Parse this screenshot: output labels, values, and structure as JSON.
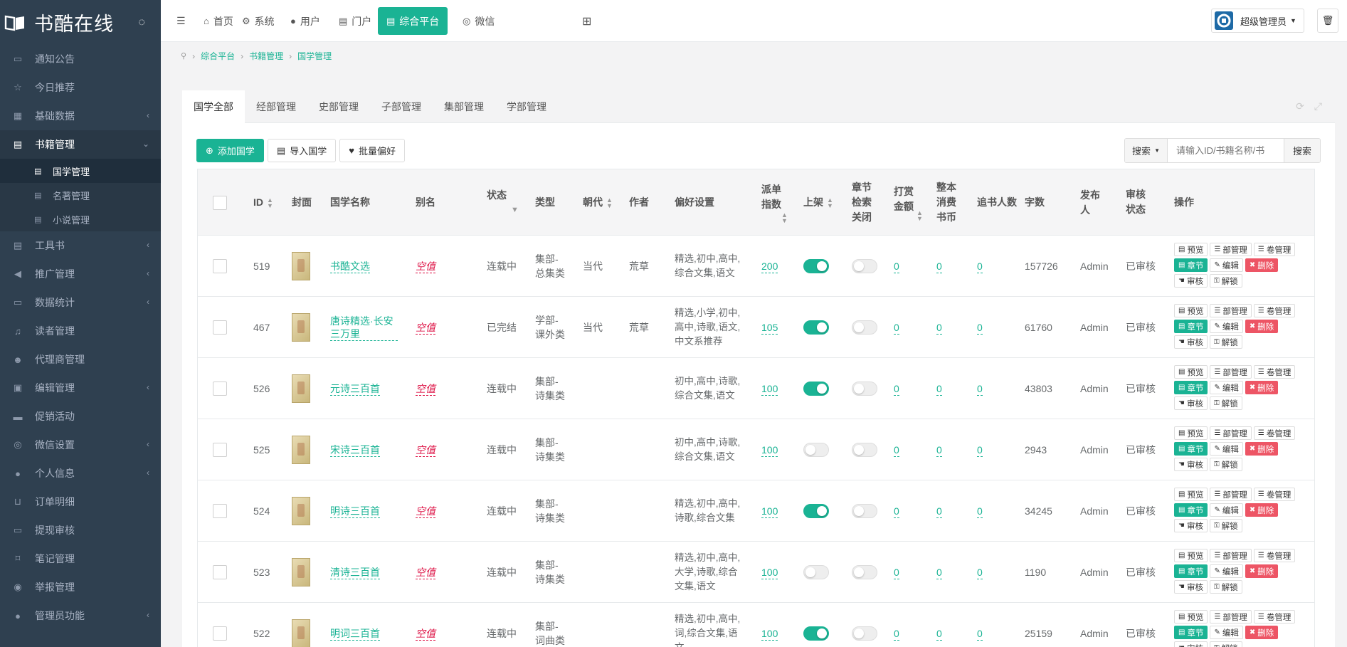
{
  "app": {
    "title": "书酷在线"
  },
  "sidebar": {
    "items": [
      {
        "label": "通知公告",
        "icon": "folder-icon",
        "arrow": false
      },
      {
        "label": "今日推荐",
        "icon": "star-icon",
        "arrow": false
      },
      {
        "label": "基础数据",
        "icon": "cubes-icon",
        "arrow": true
      },
      {
        "label": "书籍管理",
        "icon": "book-icon",
        "arrow": true,
        "active": true
      },
      {
        "label": "工具书",
        "icon": "book-icon",
        "arrow": true
      },
      {
        "label": "推广管理",
        "icon": "bullhorn-icon",
        "arrow": true
      },
      {
        "label": "数据统计",
        "icon": "folder-icon",
        "arrow": true
      },
      {
        "label": "读者管理",
        "icon": "headphones-icon",
        "arrow": false
      },
      {
        "label": "代理商管理",
        "icon": "users-icon",
        "arrow": false
      },
      {
        "label": "编辑管理",
        "icon": "user-card-icon",
        "arrow": true
      },
      {
        "label": "促销活动",
        "icon": "laptop-icon",
        "arrow": false
      },
      {
        "label": "微信设置",
        "icon": "wechat-icon",
        "arrow": true
      },
      {
        "label": "个人信息",
        "icon": "user-icon",
        "arrow": true
      },
      {
        "label": "订单明细",
        "icon": "cart-icon",
        "arrow": false
      },
      {
        "label": "提现审核",
        "icon": "money-icon",
        "arrow": false
      },
      {
        "label": "笔记管理",
        "icon": "bookmark-icon",
        "arrow": false
      },
      {
        "label": "举报管理",
        "icon": "comment-icon",
        "arrow": false
      },
      {
        "label": "管理员功能",
        "icon": "user-icon",
        "arrow": true
      }
    ],
    "sub_items": [
      {
        "label": "国学管理",
        "active": true
      },
      {
        "label": "名著管理"
      },
      {
        "label": "小说管理"
      }
    ]
  },
  "topbar": {
    "menu": [
      {
        "label": "首页",
        "icon": "home-icon"
      },
      {
        "label": "系统",
        "icon": "gear-icon"
      },
      {
        "label": "用户",
        "icon": "user-icon"
      },
      {
        "label": "门户",
        "icon": "newspaper-icon"
      },
      {
        "label": "综合平台",
        "icon": "newspaper-icon",
        "active": true
      },
      {
        "label": "微信",
        "icon": "wechat-icon"
      }
    ],
    "admin_label": "超级管理员"
  },
  "breadcrumb": [
    "综合平台",
    "书籍管理",
    "国学管理"
  ],
  "tabs": [
    "国学全部",
    "经部管理",
    "史部管理",
    "子部管理",
    "集部管理",
    "学部管理"
  ],
  "toolbar": {
    "add": "添加国学",
    "import": "导入国学",
    "batch": "批量偏好"
  },
  "search": {
    "select_label": "搜索",
    "placeholder": "请输入ID/书籍名称/书",
    "button": "搜索"
  },
  "table": {
    "headers": {
      "id": "ID",
      "cover": "封面",
      "name": "国学名称",
      "alias": "别名",
      "status": "状态",
      "type": "类型",
      "dynasty": "朝代",
      "author": "作者",
      "pref": "偏好设置",
      "dispatch": "派单指数",
      "shelf": "上架",
      "chapter_close": "章节检索关闭",
      "tip": "打赏金额",
      "whole": "整本消费书币",
      "follow": "追书人数",
      "words": "字数",
      "publisher": "发布人",
      "audit": "审核状态",
      "ops": "操作"
    },
    "ops_labels": {
      "preview": "预览",
      "part": "部管理",
      "volume": "卷管理",
      "chapter": "章节",
      "edit": "编辑",
      "delete": "删除",
      "audit": "审核",
      "unlock": "解锁"
    },
    "rows": [
      {
        "id": "519",
        "name": "书酷文选",
        "alias": "空值",
        "status": "连载中",
        "type": "集部-总集类",
        "dynasty": "当代",
        "author": "荒草",
        "pref": "精选,初中,高中,综合文集,语文",
        "dispatch": "200",
        "shelf": true,
        "chapter_close": false,
        "tip": "0",
        "whole": "0",
        "follow": "0",
        "words": "157726",
        "publisher": "Admin",
        "audit": "已审核"
      },
      {
        "id": "467",
        "name": "唐诗精选·长安三万里",
        "alias": "空值",
        "status": "已完结",
        "type": "学部-课外类",
        "dynasty": "当代",
        "author": "荒草",
        "pref": "精选,小学,初中,高中,诗歌,语文,中文系推荐",
        "dispatch": "105",
        "shelf": true,
        "chapter_close": false,
        "tip": "0",
        "whole": "0",
        "follow": "0",
        "words": "61760",
        "publisher": "Admin",
        "audit": "已审核"
      },
      {
        "id": "526",
        "name": "元诗三百首",
        "alias": "空值",
        "status": "连载中",
        "type": "集部-诗集类",
        "dynasty": "",
        "author": "",
        "pref": "初中,高中,诗歌,综合文集,语文",
        "dispatch": "100",
        "shelf": true,
        "chapter_close": false,
        "tip": "0",
        "whole": "0",
        "follow": "0",
        "words": "43803",
        "publisher": "Admin",
        "audit": "已审核"
      },
      {
        "id": "525",
        "name": "宋诗三百首",
        "alias": "空值",
        "status": "连载中",
        "type": "集部-诗集类",
        "dynasty": "",
        "author": "",
        "pref": "初中,高中,诗歌,综合文集,语文",
        "dispatch": "100",
        "shelf": false,
        "chapter_close": false,
        "tip": "0",
        "whole": "0",
        "follow": "0",
        "words": "2943",
        "publisher": "Admin",
        "audit": "已审核"
      },
      {
        "id": "524",
        "name": "明诗三百首",
        "alias": "空值",
        "status": "连载中",
        "type": "集部-诗集类",
        "dynasty": "",
        "author": "",
        "pref": "精选,初中,高中,诗歌,综合文集",
        "dispatch": "100",
        "shelf": true,
        "chapter_close": false,
        "tip": "0",
        "whole": "0",
        "follow": "0",
        "words": "34245",
        "publisher": "Admin",
        "audit": "已审核"
      },
      {
        "id": "523",
        "name": "清诗三百首",
        "alias": "空值",
        "status": "连载中",
        "type": "集部-诗集类",
        "dynasty": "",
        "author": "",
        "pref": "精选,初中,高中,大学,诗歌,综合文集,语文",
        "dispatch": "100",
        "shelf": false,
        "chapter_close": false,
        "tip": "0",
        "whole": "0",
        "follow": "0",
        "words": "1190",
        "publisher": "Admin",
        "audit": "已审核"
      },
      {
        "id": "522",
        "name": "明词三百首",
        "alias": "空值",
        "status": "连载中",
        "type": "集部-词曲类",
        "dynasty": "",
        "author": "",
        "pref": "精选,初中,高中,词,综合文集,语文",
        "dispatch": "100",
        "shelf": true,
        "chapter_close": false,
        "tip": "0",
        "whole": "0",
        "follow": "0",
        "words": "25159",
        "publisher": "Admin",
        "audit": "已审核"
      }
    ]
  }
}
